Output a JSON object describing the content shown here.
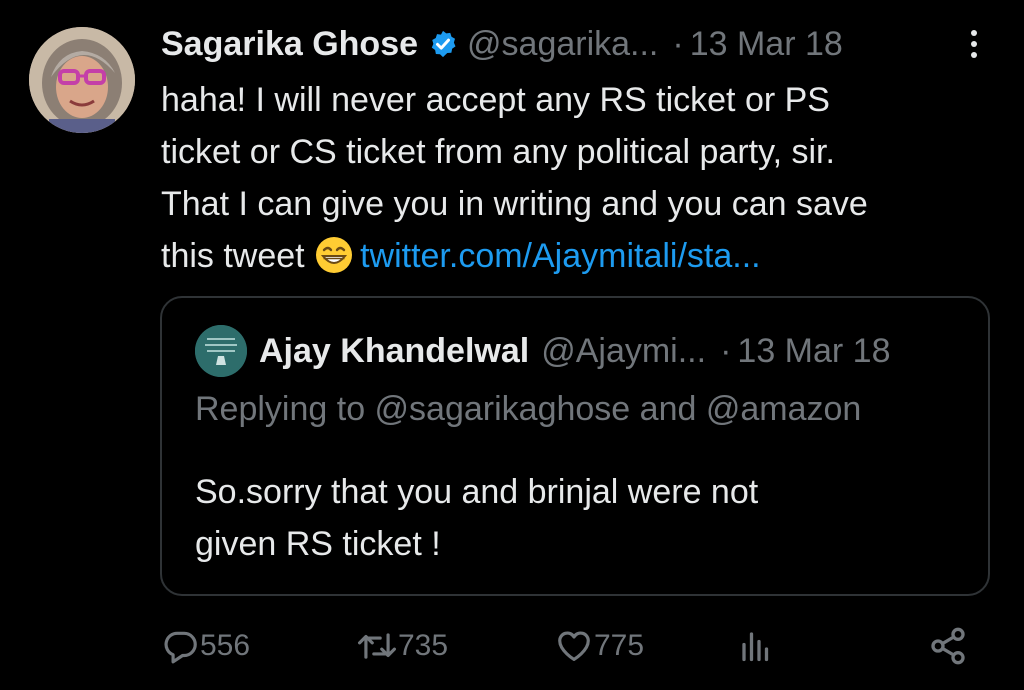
{
  "tweet": {
    "author_name": "Sagarika Ghose",
    "author_handle": "@sagarika...",
    "separator": "·",
    "date": "13 Mar 18",
    "text_lines": [
      "haha! I will never accept any RS ticket or PS",
      "ticket or CS ticket from any political party, sir.",
      "That I can give you in writing and you can save",
      "this tweet "
    ],
    "link": "twitter.com/Ajaymitali/sta...",
    "verified_color": "#1d9bf0",
    "link_color": "#1d9bf0"
  },
  "quote": {
    "author_name": "Ajay Khandelwal",
    "author_handle": "@Ajaymi...",
    "separator": "·",
    "date": "13 Mar 18",
    "replying_prefix": "Replying to ",
    "replying_user1": "@sagarikaghose",
    "replying_and": " and ",
    "replying_user2": "@amazon",
    "text_lines": [
      "So.sorry that you and brinjal were not",
      "given RS ticket !"
    ]
  },
  "actions": {
    "replies": "556",
    "retweets": "735",
    "likes": "775",
    "icons": [
      "reply-icon",
      "retweet-icon",
      "like-icon",
      "views-icon",
      "share-icon"
    ]
  }
}
